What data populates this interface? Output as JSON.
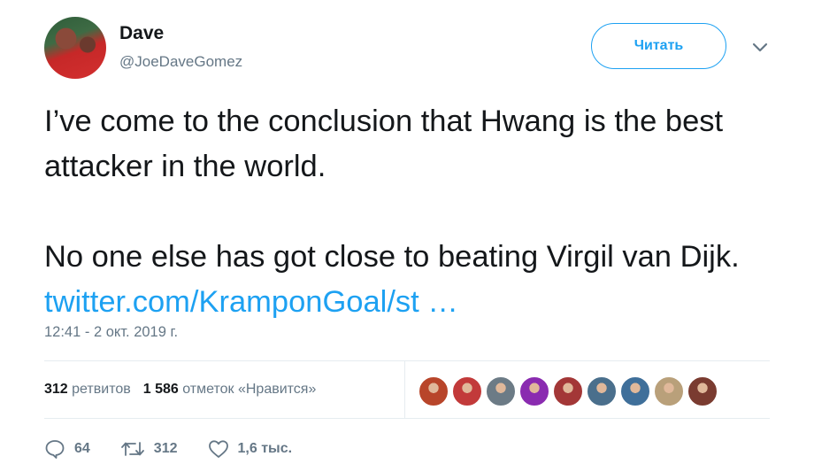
{
  "user": {
    "name": "Dave",
    "handle": "@JoeDaveGomez"
  },
  "follow_label": "Читать",
  "tweet": {
    "text": "I’ve come to the conclusion that Hwang is the best attacker in the world.\n\nNo one else has got close to beating Virgil van Dijk. ",
    "link": "twitter.com/KramponGoal/st …",
    "timestamp": "12:41 - 2 окт. 2019 г."
  },
  "stats": {
    "retweets_count": "312",
    "retweets_label": "ретвитов",
    "likes_count": "1 586",
    "likes_label": "отметок «Нравится»"
  },
  "liker_colors": [
    "#b8452a",
    "#c23a3a",
    "#6c7b86",
    "#8a2bb0",
    "#a33737",
    "#4a6f8c",
    "#3f6f9a",
    "#b9a07a",
    "#7a3b30"
  ],
  "actions": {
    "replies": "64",
    "retweets": "312",
    "likes": "1,6 тыс."
  }
}
